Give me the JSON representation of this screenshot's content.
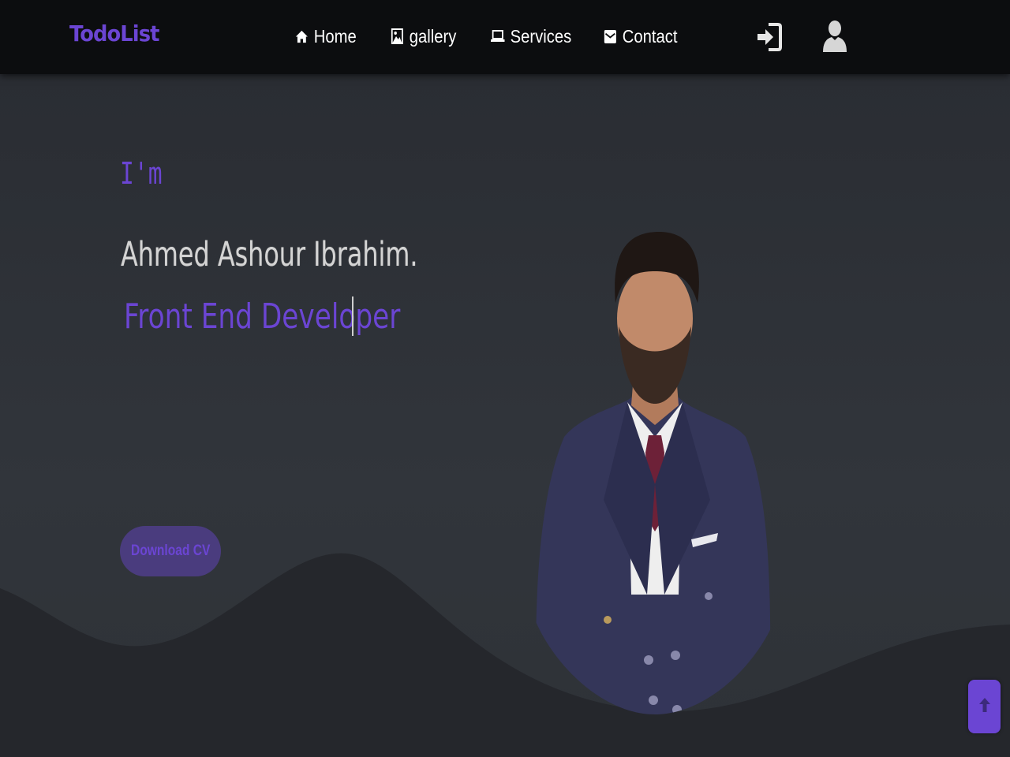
{
  "navbar": {
    "brand": "TodoList",
    "links": [
      {
        "label": "Home",
        "icon": "home-icon"
      },
      {
        "label": "gallery",
        "icon": "image-icon"
      },
      {
        "label": "Services",
        "icon": "laptop-icon"
      },
      {
        "label": "Contact",
        "icon": "envelope-icon"
      }
    ],
    "actions": [
      {
        "icon": "sign-in-icon"
      },
      {
        "icon": "user-icon"
      }
    ]
  },
  "hero": {
    "intro": "I'm",
    "name": "Ahmed Ashour Ibrahim.",
    "role": "Front End Developer",
    "cta_label": "Download CV"
  },
  "scroll_top": {
    "icon": "arrow-up-icon"
  },
  "colors": {
    "accent": "#6b45d3",
    "navbar_bg": "#0c0d0f",
    "hero_bg": "#2a2d32",
    "name_text": "#d4d4d4",
    "button_bg": "#4a3c7e"
  }
}
